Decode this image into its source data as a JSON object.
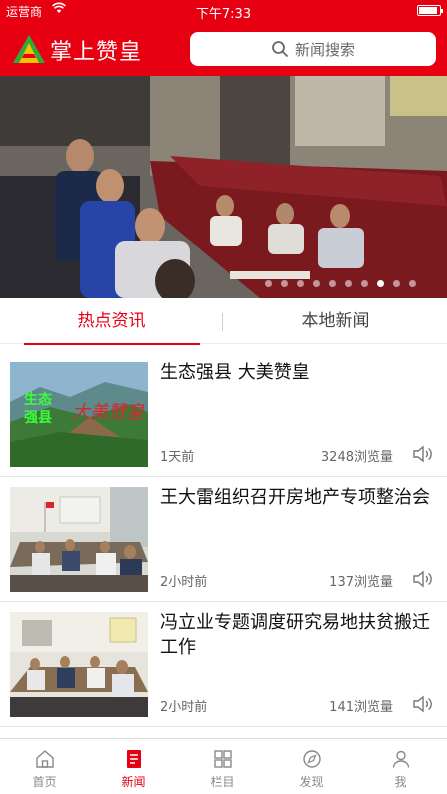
{
  "status_bar": {
    "carrier": "运营商",
    "time": "下午7:33"
  },
  "header": {
    "app_title": "掌上赞皇",
    "search_placeholder": "新闻搜索"
  },
  "banner": {
    "slide_count": 10,
    "active_slide": 8
  },
  "tabs": [
    {
      "label": "热点资讯",
      "active": true
    },
    {
      "label": "本地新闻",
      "active": false
    }
  ],
  "news": [
    {
      "title": "生态强县 大美赞皇",
      "time": "1天前",
      "views": "3248浏览量",
      "thumb_overlay_green": "生态",
      "thumb_overlay_green2": "强县",
      "thumb_overlay_script": "大美赞皇"
    },
    {
      "title": "王大雷组织召开房地产专项整治会",
      "time": "2小时前",
      "views": "137浏览量"
    },
    {
      "title": "冯立业专题调度研究易地扶贫搬迁工作",
      "time": "2小时前",
      "views": "141浏览量"
    }
  ],
  "tabbar": [
    {
      "label": "首页",
      "icon": "home-icon",
      "active": false
    },
    {
      "label": "新闻",
      "icon": "news-icon",
      "active": true
    },
    {
      "label": "栏目",
      "icon": "grid-icon",
      "active": false
    },
    {
      "label": "发现",
      "icon": "compass-icon",
      "active": false
    },
    {
      "label": "我",
      "icon": "user-icon",
      "active": false
    }
  ],
  "colors": {
    "brand_red": "#e60012",
    "tab_inactive": "#888888"
  }
}
